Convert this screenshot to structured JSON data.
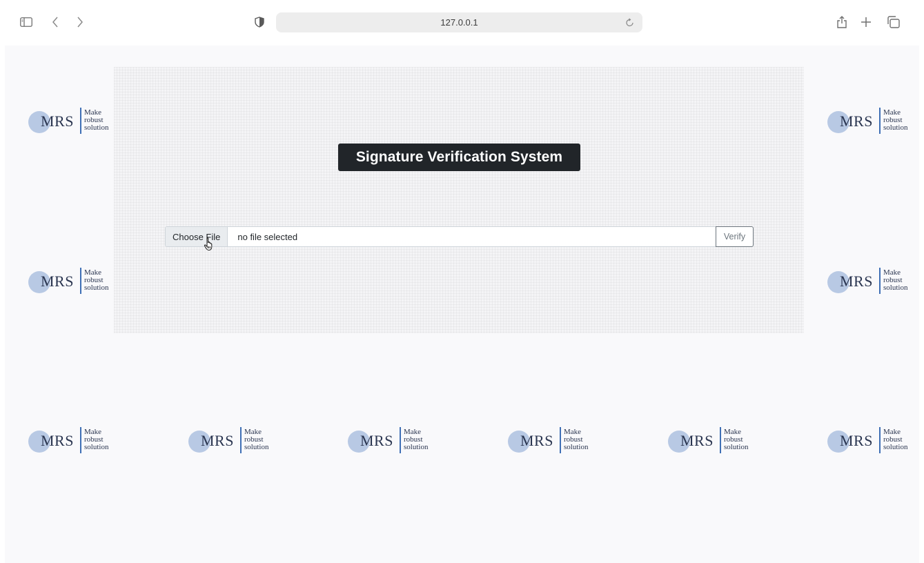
{
  "browser": {
    "url": "127.0.0.1"
  },
  "header": {
    "title": "Signature Verification System"
  },
  "upload": {
    "choose_label": "Choose File",
    "status_text": "no file selected",
    "verify_label": "Verify"
  },
  "logo": {
    "abbr": "MRS",
    "line1": "Make",
    "line2": "robust",
    "line3": "solution"
  },
  "colors": {
    "title_bg": "#212529",
    "logo_circle": "#b8c9e4",
    "logo_bar": "#3f6fb5"
  }
}
